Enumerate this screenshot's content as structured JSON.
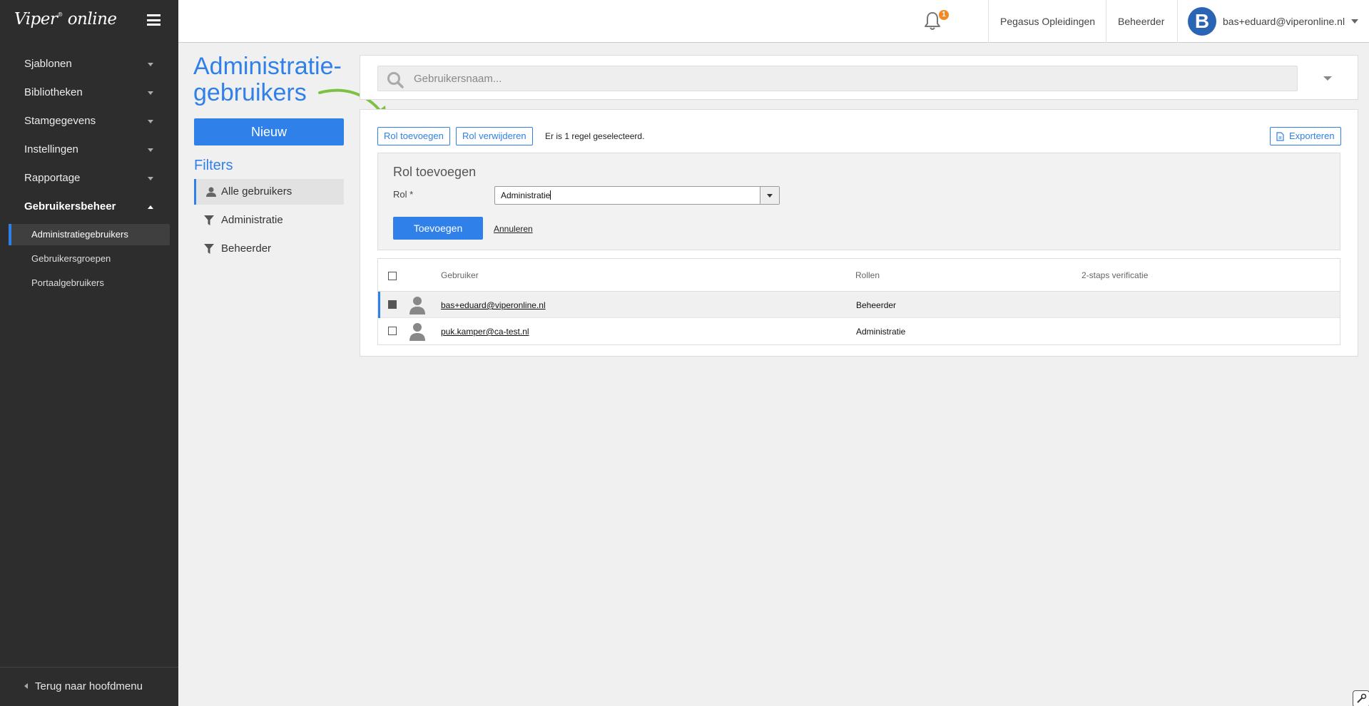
{
  "app": {
    "logo_brand": "Viper",
    "logo_reg": "®",
    "logo_suffix": "online"
  },
  "sidebar": {
    "items": [
      {
        "label": "Sjablonen"
      },
      {
        "label": "Bibliotheken"
      },
      {
        "label": "Stamgegevens"
      },
      {
        "label": "Instellingen"
      },
      {
        "label": "Rapportage"
      },
      {
        "label": "Gebruikersbeheer"
      }
    ],
    "sub_items": [
      {
        "label": "Administratiegebruikers"
      },
      {
        "label": "Gebruikersgroepen"
      },
      {
        "label": "Portaalgebruikers"
      }
    ],
    "back_label": "Terug naar hoofdmenu"
  },
  "topbar": {
    "notification_count": "1",
    "org_label": "Pegasus Opleidingen",
    "role_label": "Beheerder",
    "avatar_letter": "B",
    "user_email": "bas+eduard@viperonline.nl"
  },
  "page": {
    "title_line1": "Administratie-",
    "title_line2": "gebruikers",
    "new_button": "Nieuw"
  },
  "filters": {
    "title": "Filters",
    "items": [
      {
        "label": "Alle gebruikers",
        "icon": "user-icon"
      },
      {
        "label": "Administratie",
        "icon": "filter-icon"
      },
      {
        "label": "Beheerder",
        "icon": "filter-icon"
      }
    ]
  },
  "search": {
    "placeholder": "Gebruikersnaam..."
  },
  "toolbar": {
    "add_role": "Rol toevoegen",
    "remove_role": "Rol verwijderen",
    "selection_info": "Er is 1 regel geselecteerd.",
    "export": "Exporteren"
  },
  "add_role_form": {
    "title": "Rol toevoegen",
    "role_label": "Rol *",
    "role_value": "Administratie",
    "submit": "Toevoegen",
    "cancel": "Annuleren"
  },
  "table": {
    "columns": [
      "Gebruiker",
      "Rollen",
      "2-staps verificatie"
    ],
    "rows": [
      {
        "user": "bas+eduard@viperonline.nl",
        "roles": "Beheerder",
        "two_factor": "",
        "selected": true
      },
      {
        "user": "puk.kamper@ca-test.nl",
        "roles": "Administratie",
        "two_factor": "",
        "selected": false
      }
    ]
  },
  "colors": {
    "accent": "#2f80e8",
    "sidebar_bg": "#2d2d2d",
    "badge": "#f08a24",
    "arrow": "#7cc142"
  }
}
